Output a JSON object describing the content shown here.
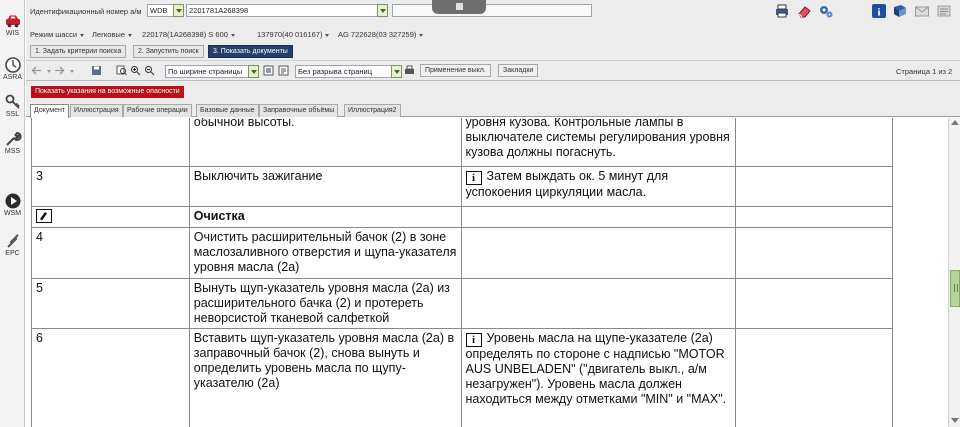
{
  "leftbar": {
    "items": [
      {
        "label": "WIS",
        "icon": "car-icon"
      },
      {
        "label": "ASRA",
        "icon": "clock-icon"
      },
      {
        "label": "SSL",
        "icon": "key-icon"
      },
      {
        "label": "MSS",
        "icon": "wrench-icon"
      },
      {
        "label": "WSM",
        "icon": "play-icon"
      },
      {
        "label": "EPC",
        "icon": "spark-plug-icon"
      }
    ]
  },
  "header": {
    "vin_label": "Идентификационный номер а/м",
    "vin_prefix": "WDB",
    "vin_value": "2201781A268398",
    "toolbar_icons": [
      "print-icon",
      "eraser-icon",
      "gears-icon",
      "info-icon",
      "book-icon",
      "envelope-icon",
      "settings-icon"
    ]
  },
  "chassis": {
    "mode_label": "Режим шасси",
    "type": "Легковые",
    "model": "220178(1A268398) S 600",
    "engine": "137970(40 016167)",
    "transmission": "AG 722628(03 327259)"
  },
  "steps": [
    {
      "label": "1. Задать критерии поиска",
      "active": false
    },
    {
      "label": "2. Запустить поиск",
      "active": false
    },
    {
      "label": "3. Показать документы",
      "active": true
    }
  ],
  "doc_toolbar": {
    "zoom_value": "По ширине страницы",
    "break_value": "Без разрыва страниц",
    "apply_label": "Применение выкл.",
    "bookmarks_label": "Закладки",
    "page_info": "Страница 1 из 2"
  },
  "warning_button": "Показать указания на возможные опасности",
  "tabs": [
    {
      "label": "Документ",
      "active": true
    },
    {
      "label": "Иллюстрация",
      "active": false
    },
    {
      "label": "Рабочие операции",
      "active": false
    },
    {
      "label": "Базовые данные",
      "active": false
    },
    {
      "label": "Заправочные объёмы",
      "active": false
    },
    {
      "label": "Иллюстрация2",
      "active": false
    }
  ],
  "doc_rows": [
    {
      "num": "",
      "action": "обычной высоты.",
      "note": "уровня кузова. Контрольные лампы в выключателе системы регулирования уровня кузова должны погаснуть.",
      "note_icon": false
    },
    {
      "num": "3",
      "action": "Выключить зажигание",
      "note": "Затем выждать ок. 5 минут для успокоения циркуляции масла.",
      "note_icon": true
    },
    {
      "num": "",
      "action": "Очистка",
      "note": "",
      "note_icon": false,
      "heading": true
    },
    {
      "num": "4",
      "action": "Очистить расширительный бачок (2) в зоне маслозаливного отверстия и щупа-указателя уровня масла (2a)",
      "note": "",
      "note_icon": false
    },
    {
      "num": "5",
      "action": "Вынуть щуп-указатель уровня масла (2a) из расширительного бачка (2) и протереть неворсистой тканевой салфеткой",
      "note": "",
      "note_icon": false
    },
    {
      "num": "6",
      "action": "Вставить щуп-указатель уровня масла (2a) в заправочный бачок (2), снова вынуть и определить уровень масла по щупу-указателю (2a)",
      "note": "Уровень масла на щупе-указателе (2a) определять по стороне с надписью \"MOTOR AUS UNBELADEN\" (\"двигатель выкл., а/м незагружен\"). Уровень масла должен находиться между отметками \"MIN\" и \"MAX\".",
      "note_icon": true
    }
  ]
}
